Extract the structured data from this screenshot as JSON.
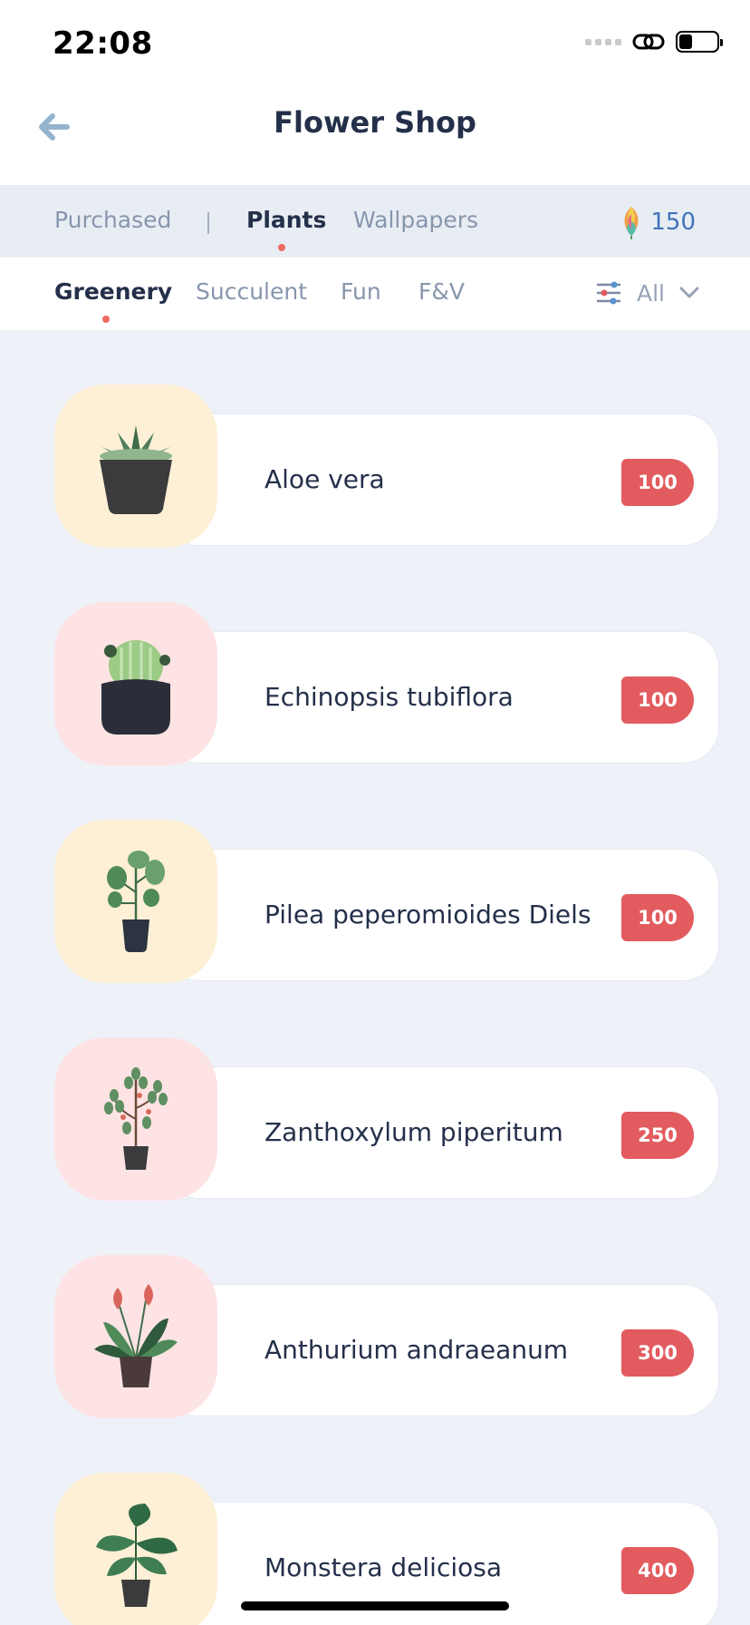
{
  "status_bar": {
    "time": "22:08"
  },
  "header": {
    "title": "Flower Shop"
  },
  "tabs": [
    {
      "label": "Purchased"
    },
    {
      "label": "Plants"
    },
    {
      "label": "Wallpapers"
    }
  ],
  "balance": {
    "value": "150"
  },
  "filters": {
    "categories": [
      {
        "label": "Greenery"
      },
      {
        "label": "Succulent"
      },
      {
        "label": "Fun"
      },
      {
        "label": "F&V"
      }
    ],
    "selected": "All"
  },
  "plants": [
    {
      "name": "Aloe vera",
      "price": "100",
      "bg": "#fdf0d6"
    },
    {
      "name": "Echinopsis tubiflora",
      "price": "100",
      "bg": "#fde3e3"
    },
    {
      "name": "Pilea peperomioides Diels",
      "price": "100",
      "bg": "#fdf0d6"
    },
    {
      "name": "Zanthoxylum piperitum",
      "price": "250",
      "bg": "#fde3e3"
    },
    {
      "name": "Anthurium andraeanum",
      "price": "300",
      "bg": "#fde3e3"
    },
    {
      "name": "Monstera deliciosa",
      "price": "400",
      "bg": "#fdf0d6"
    }
  ],
  "colors": {
    "accent": "#e25b5e",
    "active_dot": "#ec6a62",
    "coin_text": "#3f74b8"
  }
}
